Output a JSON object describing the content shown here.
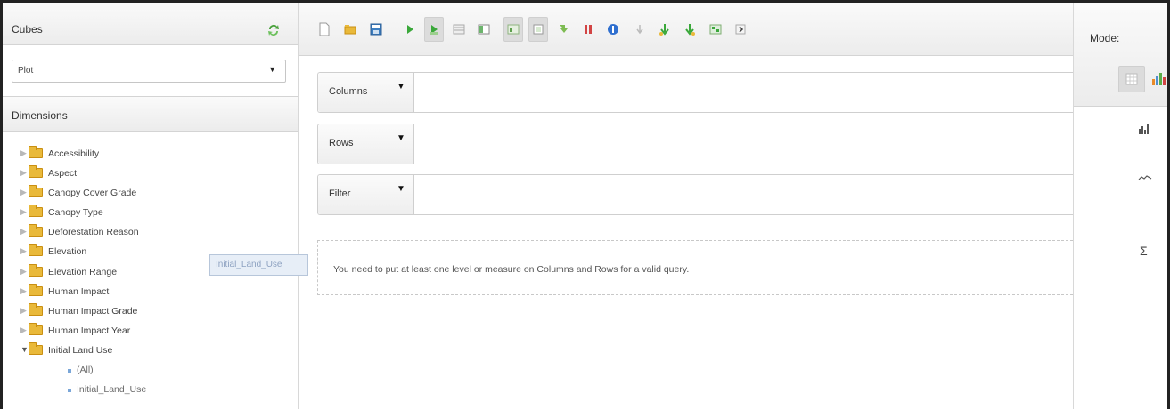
{
  "left_panel": {
    "cubes_title": "Cubes",
    "cube_select": {
      "value": "Plot"
    },
    "dimensions_title": "Dimensions",
    "tree": [
      {
        "label": "Accessibility",
        "expanded": false
      },
      {
        "label": "Aspect",
        "expanded": false
      },
      {
        "label": "Canopy Cover Grade",
        "expanded": false
      },
      {
        "label": "Canopy Type",
        "expanded": false
      },
      {
        "label": "Deforestation Reason",
        "expanded": false
      },
      {
        "label": "Elevation",
        "expanded": false
      },
      {
        "label": "Elevation Range",
        "expanded": false
      },
      {
        "label": "Human Impact",
        "expanded": false
      },
      {
        "label": "Human Impact Grade",
        "expanded": false
      },
      {
        "label": "Human Impact Year",
        "expanded": false
      },
      {
        "label": "Initial Land Use",
        "expanded": true
      }
    ],
    "tree_children": [
      "(All)",
      "Initial_Land_Use"
    ]
  },
  "drag_ghost": {
    "label": "Initial_Land_Use"
  },
  "toolbar": {
    "icons": [
      "new-query-icon",
      "open-query-icon",
      "save-query-icon",
      "run-icon",
      "auto-run-icon",
      "toggle-fields-icon",
      "toggle-sidebar-icon",
      "mdx-icon",
      "non-empty-icon",
      "swap-axes-icon",
      "show-parents-icon",
      "hide-parents-icon",
      "info-icon",
      "drill-down-icon",
      "drill-across-icon",
      "drill-through-icon",
      "export-xls-icon",
      "export-csv-icon"
    ]
  },
  "query": {
    "columns_label": "Columns",
    "rows_label": "Rows",
    "filter_label": "Filter",
    "message": "You need to put at least one level or measure on Columns and Rows for a valid query."
  },
  "mode_panel": {
    "title": "Mode:",
    "sigma": "Σ"
  },
  "colors": {
    "folder": "#e9b93a",
    "refresh_green": "#49a13b",
    "panel_header": "#ececec",
    "ghost_bg": "#e7eef7"
  }
}
